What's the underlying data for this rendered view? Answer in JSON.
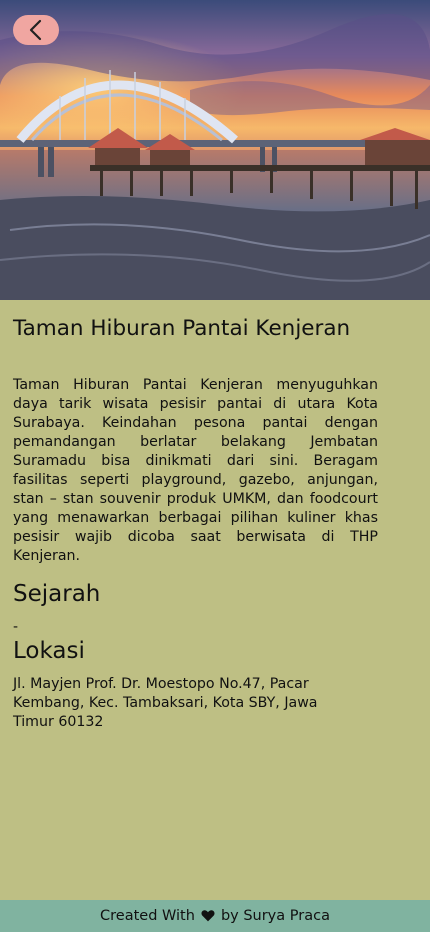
{
  "hero": {
    "image_icon": "bridge-sunset-photo"
  },
  "nav": {
    "back_icon": "chevron-left-icon"
  },
  "place": {
    "title": "Taman Hiburan Pantai Kenjeran",
    "description": "Taman Hiburan Pantai Kenjeran menyuguhkan daya tarik wisata pesisir pantai di utara Kota Surabaya. Keindahan pesona pantai dengan pemandangan berlatar belakang Jembatan Suramadu bisa dinikmati dari sini. Beragam fasilitas seperti playground, gazebo, anjungan, stan – stan souvenir produk UMKM, dan foodcourt yang menawarkan berbagai pilihan kuliner khas pesisir wajib dicoba saat berwisata di THP Kenjeran.",
    "history_heading": "Sejarah",
    "history_text": "-",
    "location_heading": "Lokasi",
    "location_text": "Jl. Mayjen Prof. Dr. Moestopo No.47, Pacar Kembang, Kec. Tambaksari, Kota SBY, Jawa Timur 60132"
  },
  "footer": {
    "prefix": "Created With",
    "heart_icon": "heart-icon",
    "suffix": "by Surya Praca"
  },
  "colors": {
    "background": "#bebf84",
    "footer": "#80b3a0",
    "back_button": "#f0a6a1"
  }
}
